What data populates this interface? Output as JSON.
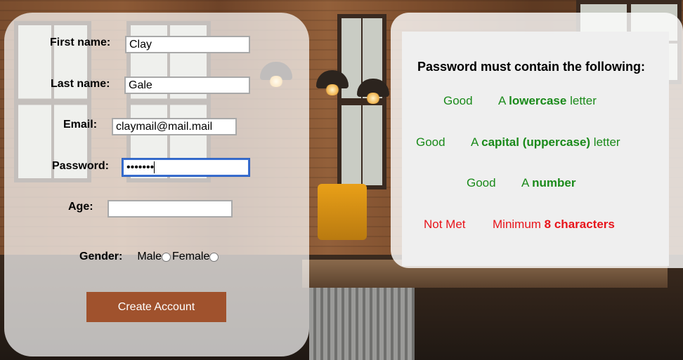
{
  "form": {
    "first_name_label": "First name:",
    "first_name_value": "Clay",
    "last_name_label": "Last name:",
    "last_name_value": "Gale",
    "email_label": "Email:",
    "email_value": "claymail@mail.mail",
    "password_label": "Password:",
    "password_value": "•••••••",
    "age_label": "Age:",
    "age_value": "",
    "gender_label": "Gender:",
    "gender_male": "Male",
    "gender_female": "Female",
    "create_button": "Create Account"
  },
  "requirements": {
    "title": "Password must contain the following:",
    "items": [
      {
        "status": "Good",
        "prefix": "A ",
        "bold": "lowercase",
        "suffix": " letter",
        "met": true
      },
      {
        "status": "Good",
        "prefix": "A ",
        "bold": "capital (uppercase)",
        "suffix": " letter",
        "met": true
      },
      {
        "status": "Good",
        "prefix": "A ",
        "bold": "number",
        "suffix": "",
        "met": true
      },
      {
        "status": "Not Met",
        "prefix": "Minimum ",
        "bold": "8 characters",
        "suffix": "",
        "met": false
      }
    ],
    "colors": {
      "good": "#1a8a1a",
      "not_met": "#e8141b"
    }
  },
  "colors": {
    "button": "#a0522d",
    "focus": "#3a6fd0"
  }
}
